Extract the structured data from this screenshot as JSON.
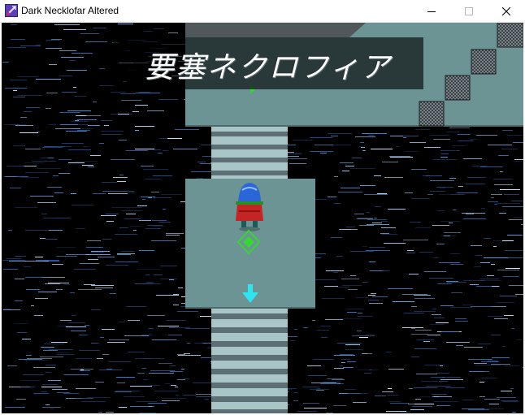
{
  "window": {
    "title": "Dark Necklofar Altered"
  },
  "game": {
    "map_name": "要塞ネクロフィア",
    "colors": {
      "floor": "#6d9494",
      "floor_edge": "#4d6b6b",
      "stairs_light": "#a9c5c5",
      "stairs_dark": "#5c6f74",
      "transfer_arrow": "#2fe3ef",
      "event_marker": "#35d635",
      "hero_hair": "#2b66d9",
      "hero_cloak": "#c42424"
    }
  }
}
